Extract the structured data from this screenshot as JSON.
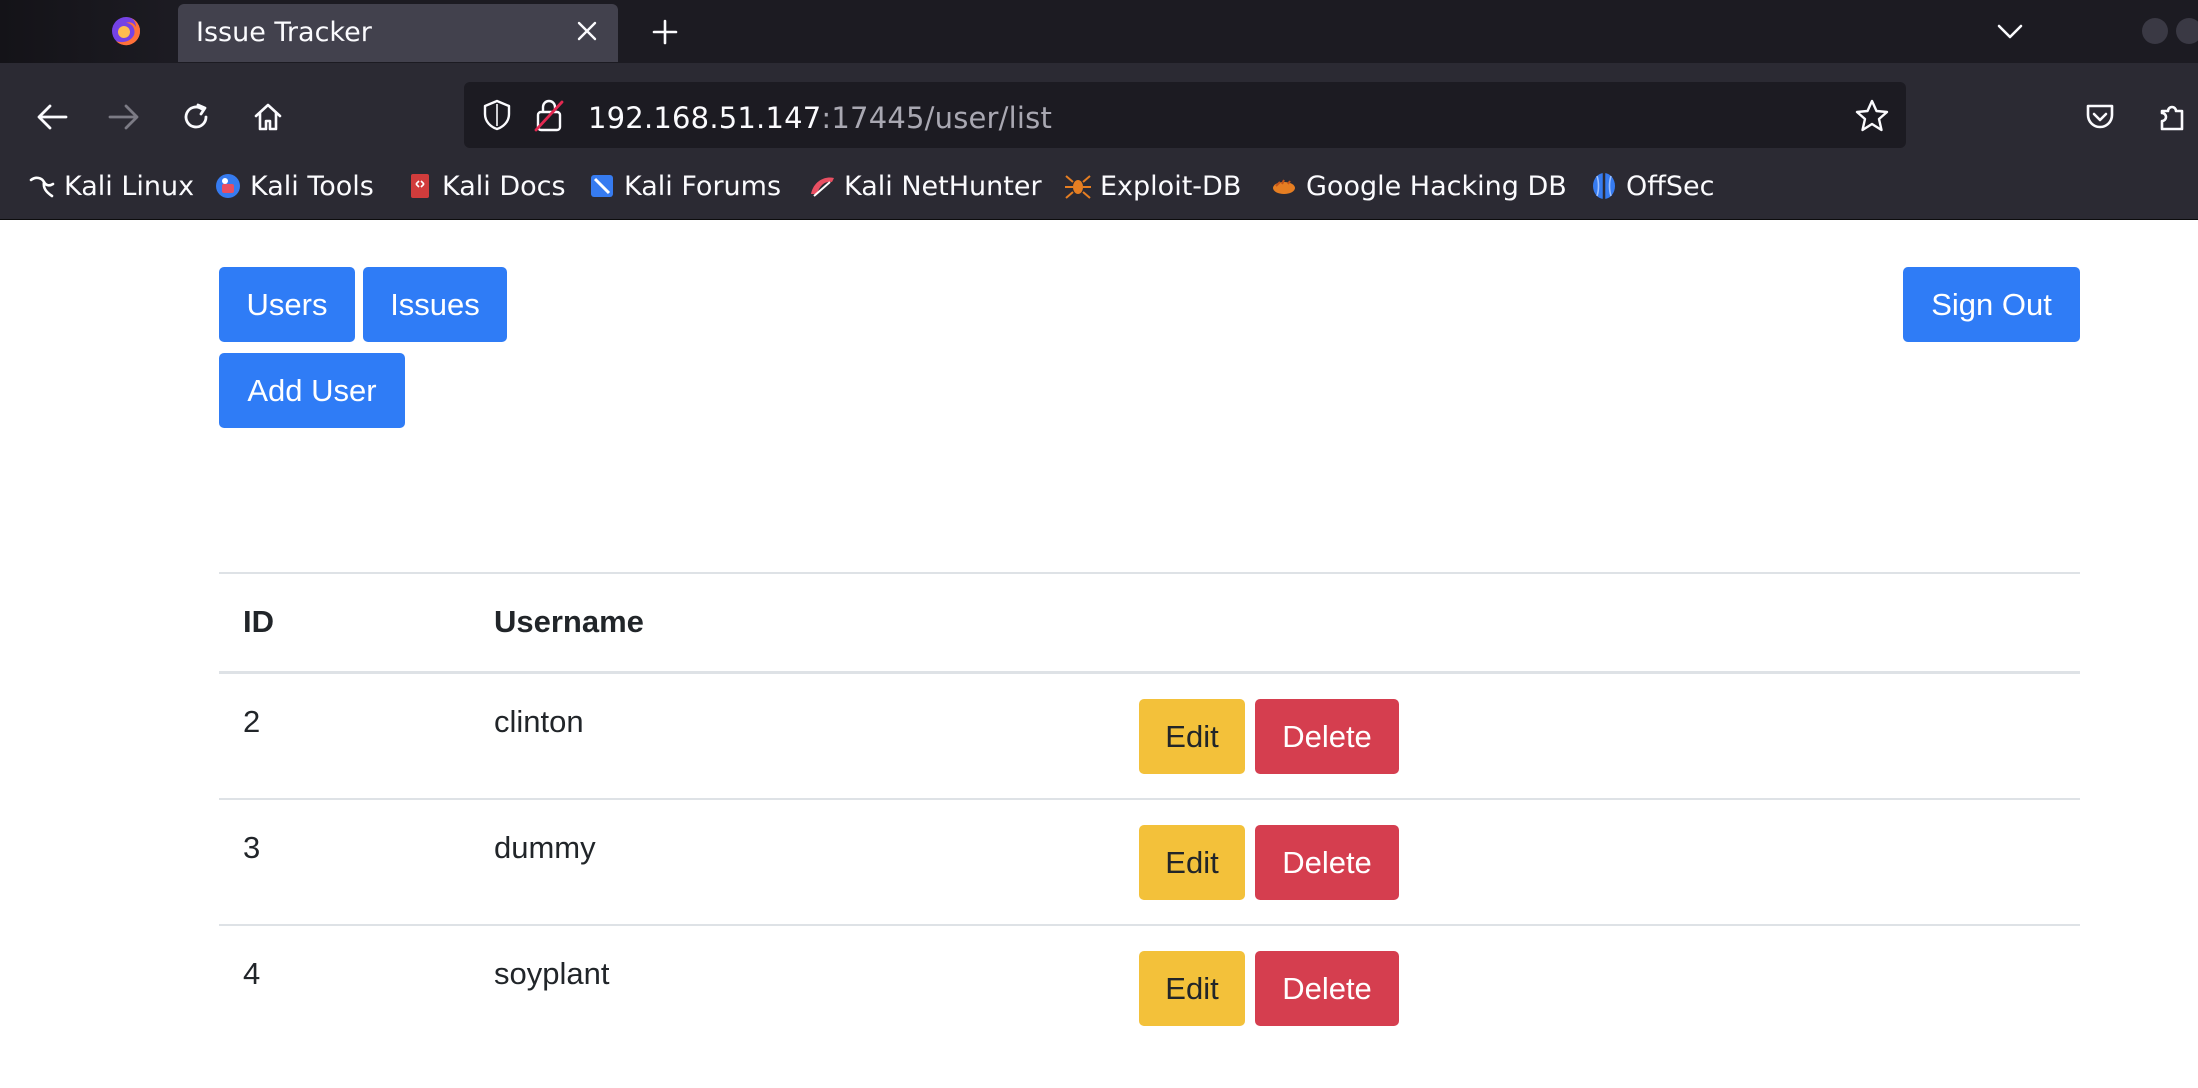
{
  "browser": {
    "tab_title": "Issue Tracker",
    "url_host": "192.168.51.147",
    "url_path": ":17445/user/list",
    "bookmarks": [
      {
        "label": "Kali Linux",
        "icon": "kali-dragon-icon"
      },
      {
        "label": "Kali Tools",
        "icon": "kali-tools-icon"
      },
      {
        "label": "Kali Docs",
        "icon": "kali-docs-icon"
      },
      {
        "label": "Kali Forums",
        "icon": "kali-forums-icon"
      },
      {
        "label": "Kali NetHunter",
        "icon": "kali-nethunter-icon"
      },
      {
        "label": "Exploit-DB",
        "icon": "exploit-db-icon"
      },
      {
        "label": "Google Hacking DB",
        "icon": "ghdb-icon"
      },
      {
        "label": "OffSec",
        "icon": "offsec-icon"
      }
    ]
  },
  "nav": {
    "users_label": "Users",
    "issues_label": "Issues",
    "sign_out_label": "Sign Out",
    "add_user_label": "Add User"
  },
  "table": {
    "headers": {
      "id": "ID",
      "username": "Username"
    },
    "rows": [
      {
        "id": "2",
        "username": "clinton",
        "edit": "Edit",
        "delete": "Delete"
      },
      {
        "id": "3",
        "username": "dummy",
        "edit": "Edit",
        "delete": "Delete"
      },
      {
        "id": "4",
        "username": "soyplant",
        "edit": "Edit",
        "delete": "Delete"
      }
    ]
  },
  "colors": {
    "primary": "#2f7cf6",
    "warning": "#f3c13a",
    "danger": "#d53e4f",
    "chrome_dark": "#1c1b22",
    "chrome_toolbar": "#2b2a33"
  }
}
